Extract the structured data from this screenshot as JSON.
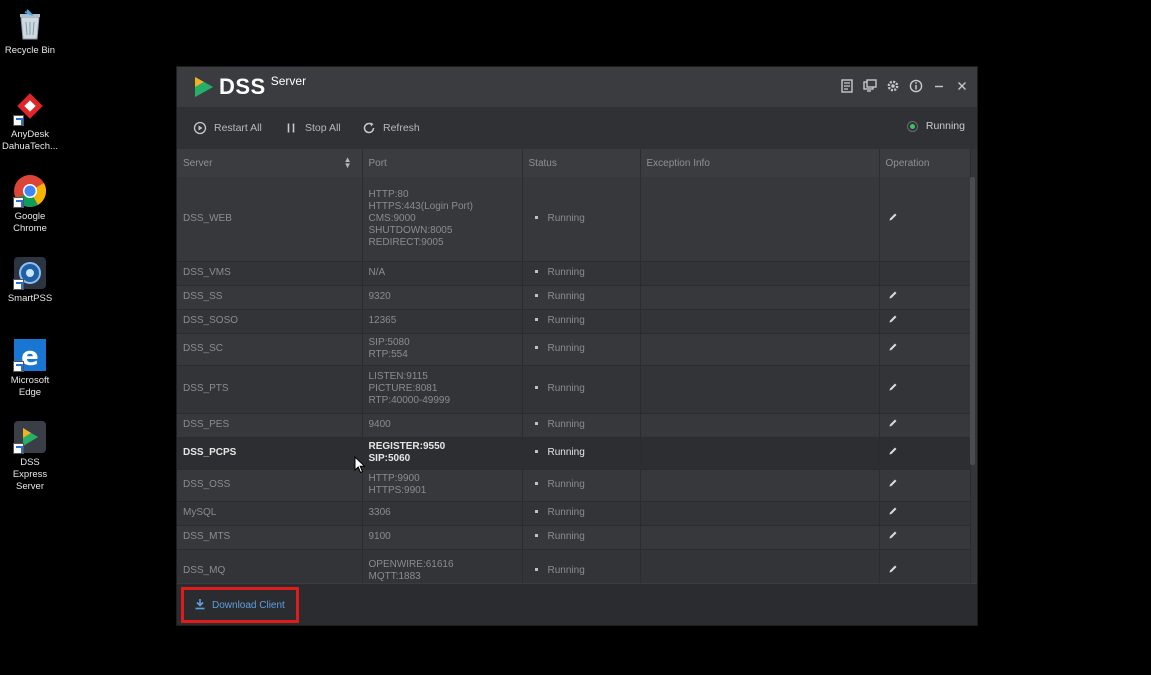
{
  "desktop": {
    "icons": [
      {
        "label": "Recycle Bin"
      },
      {
        "label": "AnyDesk DahuaTech..."
      },
      {
        "label": "Google Chrome"
      },
      {
        "label": "SmartPSS"
      },
      {
        "label": "Microsoft Edge"
      },
      {
        "label": "DSS Express Server"
      }
    ]
  },
  "window": {
    "brand": "DSS",
    "brand_sub": "Server",
    "title_icons": [
      "log-icon",
      "monitor-icon",
      "gear-icon",
      "info-icon",
      "minimize-icon",
      "close-icon"
    ]
  },
  "toolbar": {
    "restart_all": "Restart All",
    "stop_all": "Stop All",
    "refresh": "Refresh",
    "status": "Running"
  },
  "table": {
    "headers": {
      "server": "Server",
      "port": "Port",
      "status": "Status",
      "exception": "Exception Info",
      "operation": "Operation"
    },
    "rows": [
      {
        "server": "DSS_WEB",
        "ports": [
          "HTTP:80",
          "HTTPS:443(Login Port)",
          "CMS:9000",
          "SHUTDOWN:8005",
          "REDIRECT:9005"
        ],
        "status": "Running",
        "exception": "",
        "editable": true
      },
      {
        "server": "DSS_VMS",
        "ports": [
          "N/A"
        ],
        "status": "Running",
        "exception": "",
        "editable": false
      },
      {
        "server": "DSS_SS",
        "ports": [
          "9320"
        ],
        "status": "Running",
        "exception": "",
        "editable": true
      },
      {
        "server": "DSS_SOSO",
        "ports": [
          "12365"
        ],
        "status": "Running",
        "exception": "",
        "editable": true
      },
      {
        "server": "DSS_SC",
        "ports": [
          "SIP:5080",
          "RTP:554"
        ],
        "status": "Running",
        "exception": "",
        "editable": true
      },
      {
        "server": "DSS_PTS",
        "ports": [
          "LISTEN:9115",
          "PICTURE:8081",
          "RTP:40000-49999"
        ],
        "status": "Running",
        "exception": "",
        "editable": true
      },
      {
        "server": "DSS_PES",
        "ports": [
          "9400"
        ],
        "status": "Running",
        "exception": "",
        "editable": true
      },
      {
        "server": "DSS_PCPS",
        "ports": [
          "REGISTER:9550",
          "SIP:5060"
        ],
        "status": "Running",
        "exception": "",
        "editable": true
      },
      {
        "server": "DSS_OSS",
        "ports": [
          "HTTP:9900",
          "HTTPS:9901"
        ],
        "status": "Running",
        "exception": "",
        "editable": true
      },
      {
        "server": "MySQL",
        "ports": [
          "3306"
        ],
        "status": "Running",
        "exception": "",
        "editable": true
      },
      {
        "server": "DSS_MTS",
        "ports": [
          "9100"
        ],
        "status": "Running",
        "exception": "",
        "editable": true
      },
      {
        "server": "DSS_MQ",
        "ports": [
          "OPENWIRE:61616",
          "MQTT:1883"
        ],
        "status": "Running",
        "exception": "",
        "editable": true
      }
    ]
  },
  "footer": {
    "download_client": "Download Client"
  },
  "colors": {
    "highlight_border": "#e01b1b",
    "link_blue": "#5f9fe0",
    "running_green": "#3cc35a"
  }
}
